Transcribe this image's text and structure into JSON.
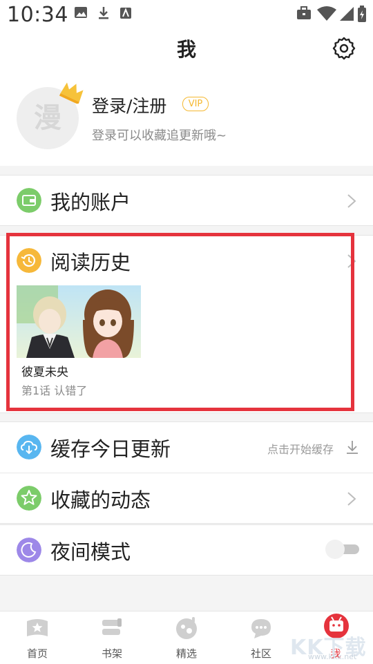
{
  "status_bar": {
    "time": "10:34"
  },
  "header": {
    "title": "我"
  },
  "profile": {
    "avatar_text": "漫",
    "login_label": "登录/注册",
    "vip_badge": "VIP",
    "subtitle": "登录可以收藏追更新哦~"
  },
  "menu": {
    "account": {
      "label": "我的账户",
      "icon": "wallet-icon",
      "color": "#7ccc6a"
    },
    "history": {
      "label": "阅读历史",
      "icon": "history-icon",
      "color": "#f6b83a",
      "items": [
        {
          "title": "彼夏未央",
          "episode": "第1话 认错了"
        }
      ]
    },
    "cache": {
      "label": "缓存今日更新",
      "action": "点击开始缓存",
      "icon": "cloud-download-icon",
      "color": "#58b6f0"
    },
    "favorites": {
      "label": "收藏的动态",
      "icon": "star-icon",
      "color": "#7ccc6a"
    },
    "night_mode": {
      "label": "夜间模式",
      "icon": "moon-icon",
      "color": "#9d88e8",
      "enabled": false
    }
  },
  "bottom_nav": [
    {
      "label": "首页",
      "icon": "home-book-icon"
    },
    {
      "label": "书架",
      "icon": "bookshelf-icon"
    },
    {
      "label": "精选",
      "icon": "featured-icon"
    },
    {
      "label": "社区",
      "icon": "community-icon"
    },
    {
      "label": "我",
      "icon": "me-icon",
      "active": true
    }
  ],
  "colors": {
    "accent": "#e5333d",
    "highlight_border": "#e5333d",
    "vip": "#f5b830"
  },
  "watermark": {
    "text": "KK下载",
    "url": "www.kkx.net"
  }
}
